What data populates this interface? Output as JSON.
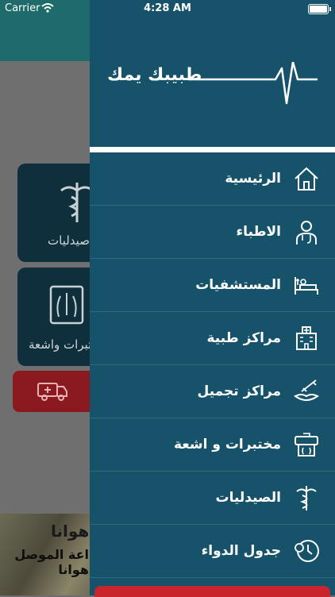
{
  "status_bar": {
    "carrier": "Carrier",
    "time": "4:28 AM"
  },
  "drawer": {
    "brand_title": "طبيبك يمك",
    "menu": [
      {
        "label": "الرئيسية",
        "icon": "home-icon"
      },
      {
        "label": "الاطباء",
        "icon": "doctor-icon"
      },
      {
        "label": "المستشفيات",
        "icon": "hospital-bed-icon"
      },
      {
        "label": "مراكز طبية",
        "icon": "medical-center-icon"
      },
      {
        "label": "مراكز تجميل",
        "icon": "cosmetic-icon"
      },
      {
        "label": "مختبرات و اشعة",
        "icon": "lab-xray-icon"
      },
      {
        "label": "الصيدليات",
        "icon": "pharmacy-icon"
      },
      {
        "label": "جدول الدواء",
        "icon": "medication-schedule-icon"
      }
    ]
  },
  "background": {
    "pharmacy_card_label": "صيدليات",
    "labs_card_label": "تبرات واشعة",
    "news_title": "هوانا",
    "news_subtitle": "اعة الموصل هوانا"
  },
  "colors": {
    "drawer_bg": "#16536b",
    "brand_accent": "#ffffff",
    "emergency": "#c8262c"
  }
}
